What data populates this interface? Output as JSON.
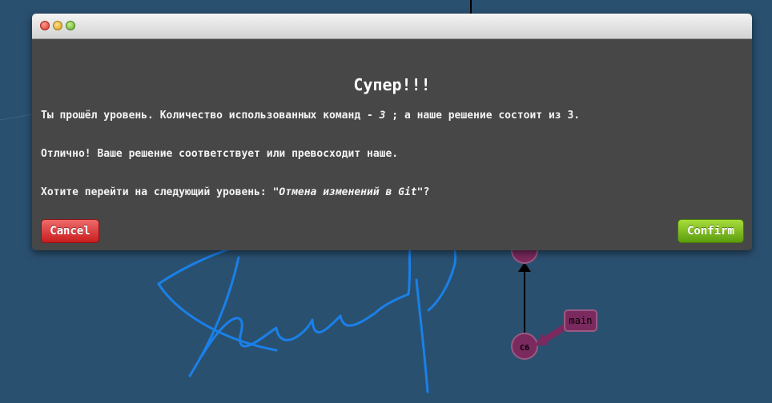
{
  "dialog": {
    "heading": "Супер!!!",
    "line1": {
      "before": "Ты прошёл уровень. Количество использованных команд - ",
      "count": "3",
      "after": " ; а наше решение состоит из 3."
    },
    "line2": "Отлично! Ваше решение соответствует или превосходит наше.",
    "line3": {
      "before": "Хотите перейти на следующий уровень: ",
      "level_name": "\"Отмена изменений в Git\"",
      "after": "?"
    },
    "cancel_label": "Cancel",
    "confirm_label": "Confirm"
  },
  "graph": {
    "node_label": "C6",
    "branch_label": "main"
  },
  "colors": {
    "background": "#2a5070",
    "dialog_bg": "#474747",
    "cancel": "#c81d1d",
    "confirm": "#5c9d0e",
    "node": "#7a2a5e",
    "scribble": "#1a80e8"
  },
  "icons": [
    "window-close-icon",
    "window-minimize-icon",
    "window-maximize-icon"
  ]
}
